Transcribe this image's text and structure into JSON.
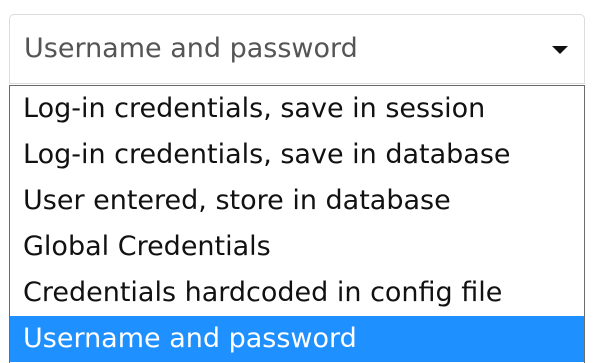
{
  "select": {
    "value": "Username and password",
    "caret_icon": "caret-down-icon"
  },
  "dropdown": {
    "selected_index": 5,
    "options": [
      {
        "label": "Log-in credentials, save in session"
      },
      {
        "label": "Log-in credentials, save in database"
      },
      {
        "label": "User entered, store in database"
      },
      {
        "label": "Global Credentials"
      },
      {
        "label": "Credentials hardcoded in config file"
      },
      {
        "label": "Username and password"
      }
    ]
  },
  "colors": {
    "selected_background": "#1e90ff",
    "selected_text": "#ffffff",
    "option_text": "#111111"
  }
}
